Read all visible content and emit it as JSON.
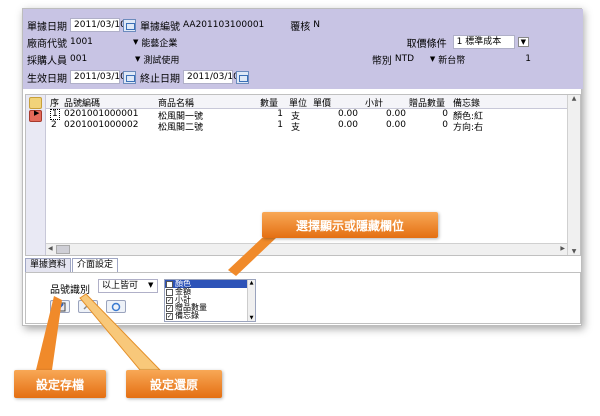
{
  "header": {
    "row1": {
      "date_label": "單據日期",
      "date_value": "2011/03/10",
      "docno_label": "單據編號",
      "docno_value": "AA201103100001",
      "review_label": "覆核",
      "review_value": "N"
    },
    "row2": {
      "vendor_label": "廠商代號",
      "vendor_code": "1001",
      "vendor_name": "能藝企業",
      "pricing_label": "取價條件",
      "pricing_value": "1 標準成本"
    },
    "row3": {
      "buyer_label": "採購人員",
      "buyer_code": "001",
      "buyer_name": "測試使用",
      "currency_label": "幣別",
      "currency_value": "NTD",
      "currency_name": "新台幣",
      "rate_value": "1"
    },
    "row4": {
      "effective_label": "生效日期",
      "effective_value": "2011/03/10",
      "end_label": "終止日期",
      "end_value": "2011/03/10"
    }
  },
  "grid": {
    "columns": [
      "序",
      "品號編碼",
      "商品名稱",
      "數量",
      "單位",
      "單價",
      "小計",
      "贈品數量",
      "備忘錄"
    ],
    "rows": [
      {
        "seq": "1",
        "code": "0201001000001",
        "name": "松風閣一號",
        "qty": "1",
        "unit": "支",
        "price": "0.00",
        "subtotal": "0.00",
        "gift": "0",
        "memo": "顏色:紅"
      },
      {
        "seq": "2",
        "code": "0201001000002",
        "name": "松風閣二號",
        "qty": "1",
        "unit": "支",
        "price": "0.00",
        "subtotal": "0.00",
        "gift": "0",
        "memo": "方向:右"
      }
    ]
  },
  "tabs": [
    "單據資料",
    "介面設定"
  ],
  "settings": {
    "filter_label": "品號識別",
    "filter_value": "以上皆可",
    "list_items": [
      {
        "label": "顏色",
        "checked": false,
        "selected": true
      },
      {
        "label": "金額",
        "checked": false,
        "selected": false
      },
      {
        "label": "小計",
        "checked": true,
        "selected": false
      },
      {
        "label": "贈品數量",
        "checked": true,
        "selected": false
      },
      {
        "label": "備忘錄",
        "checked": true,
        "selected": false
      }
    ]
  },
  "callouts": {
    "show_hide": "選擇顯示或隱藏欄位",
    "save": "設定存檔",
    "restore": "設定還原"
  },
  "colors": {
    "header_bg": "#c8c4e4",
    "callout": "#f08a2a",
    "selection": "#2d53b8"
  }
}
